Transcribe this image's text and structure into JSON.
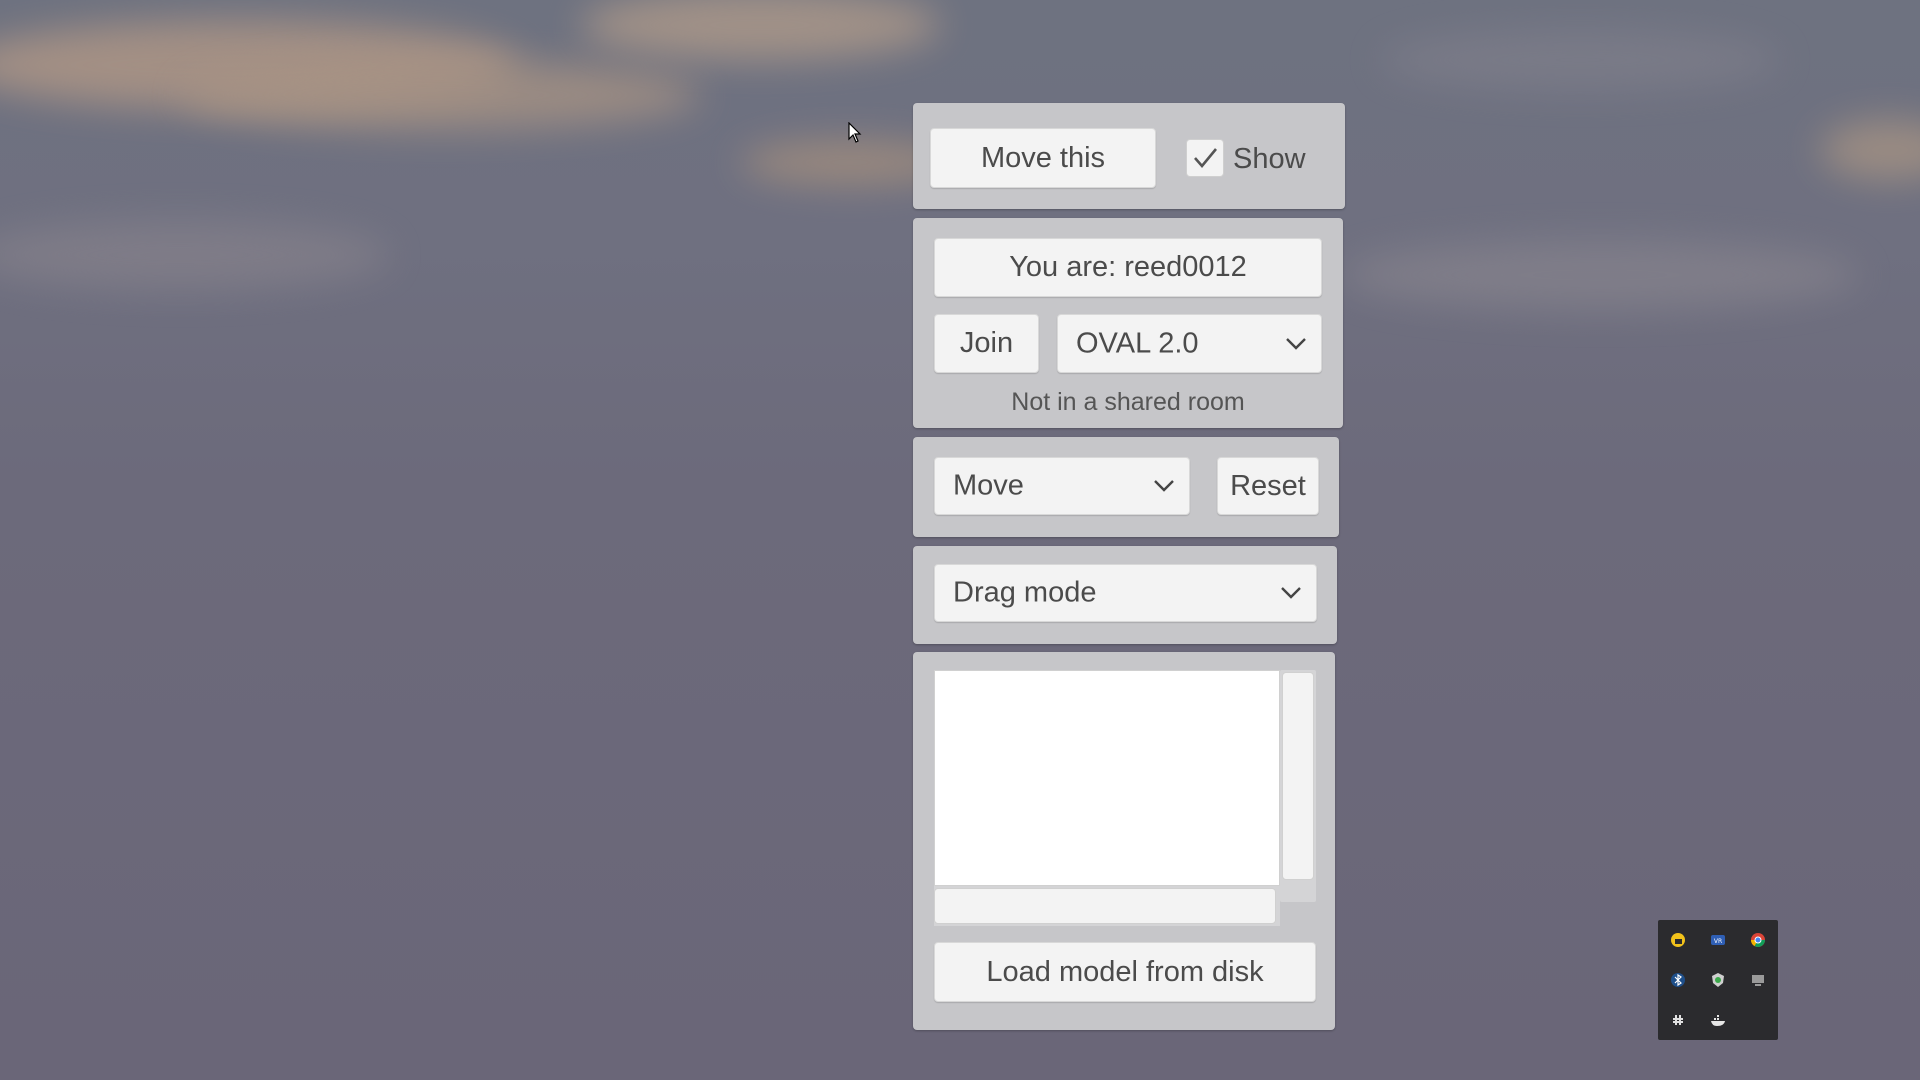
{
  "toolbar": {
    "move_this_label": "Move this",
    "show_label": "Show",
    "show_checked": true
  },
  "session": {
    "user_label": "You are: reed0012",
    "join_label": "Join",
    "room_select_value": "OVAL 2.0",
    "status_text": "Not in a shared room"
  },
  "transform": {
    "mode_select_value": "Move",
    "reset_label": "Reset"
  },
  "drag": {
    "mode_select_value": "Drag mode"
  },
  "models": {
    "list_items": [],
    "load_label": "Load model from disk"
  },
  "tray": {
    "icons": [
      "yellow-app-icon",
      "vr-icon",
      "chrome-icon",
      "bluetooth-icon",
      "security-shield-icon",
      "display-icon",
      "slack-icon",
      "docker-icon"
    ]
  },
  "colors": {
    "panel": "#c6c6c9",
    "button": "#f3f3f3",
    "text": "#4b4b4b",
    "check": "#5a9bd4"
  }
}
